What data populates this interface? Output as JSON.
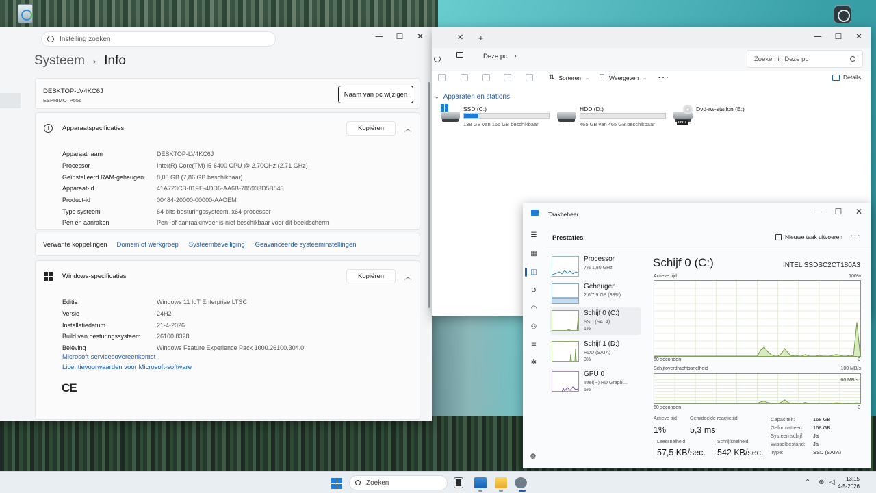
{
  "settings": {
    "search_placeholder": "Instelling zoeken",
    "breadcrumb_parent": "Systeem",
    "breadcrumb_current": "Info",
    "pc_name": "DESKTOP-LV4KC6J",
    "pc_model": "ESPRIMO_P556",
    "rename_button": "Naam van pc wijzigen",
    "device_specs": {
      "title": "Apparaatspecificaties",
      "copy_label": "Kopiëren",
      "rows": [
        {
          "k": "Apparaatnaam",
          "v": "DESKTOP-LV4KC6J"
        },
        {
          "k": "Processor",
          "v": "Intel(R) Core(TM) i5-6400 CPU @ 2.70GHz (2.71 GHz)"
        },
        {
          "k": "Geïnstalleerd RAM-geheugen",
          "v": "8,00 GB (7,86 GB beschikbaar)"
        },
        {
          "k": "Apparaat-id",
          "v": "41A723CB-01FE-4DD6-AA6B-785933D5B843"
        },
        {
          "k": "Product-id",
          "v": "00484-20000-00000-AAOEM"
        },
        {
          "k": "Type systeem",
          "v": "64-bits besturingssysteem, x64-processor"
        },
        {
          "k": "Pen en aanraken",
          "v": "Pen- of aanraakinvoer is niet beschikbaar voor dit beeldscherm"
        }
      ]
    },
    "related": {
      "label": "Verwante koppelingen",
      "links": [
        "Domein of werkgroep",
        "Systeembeveiliging",
        "Geavanceerde systeeminstellingen"
      ]
    },
    "windows_specs": {
      "title": "Windows-specificaties",
      "copy_label": "Kopiëren",
      "rows": [
        {
          "k": "Editie",
          "v": "Windows 11 IoT Enterprise LTSC"
        },
        {
          "k": "Versie",
          "v": "24H2"
        },
        {
          "k": "Installatiedatum",
          "v": "21-4-2026"
        },
        {
          "k": "Build van besturingssysteem",
          "v": "26100.8328"
        },
        {
          "k": "Beleving",
          "v": "Windows Feature Experience Pack 1000.26100.304.0"
        }
      ],
      "links": [
        "Microsoft-servicesovereenkomst",
        "Licentievoorwaarden voor Microsoft-software"
      ],
      "ce_mark": "CE"
    }
  },
  "explorer": {
    "address": "Deze pc",
    "search_placeholder": "Zoeken in Deze pc",
    "sort_label": "Sorteren",
    "view_label": "Weergeven",
    "details_label": "Details",
    "group_title": "Apparaten en stations",
    "drives": [
      {
        "name": "SSD (C:)",
        "free": "138 GB van 166 GB beschikbaar",
        "used_fraction": 0.17
      },
      {
        "name": "HDD (D:)",
        "free": "465 GB van 465 GB beschikbaar",
        "used_fraction": 0.0
      },
      {
        "name": "Dvd-rw-station (E:)",
        "badge": "DVD"
      }
    ]
  },
  "taskmgr": {
    "title": "Taakbeheer",
    "section": "Prestaties",
    "run_task": "Nieuwe taak uitvoeren",
    "items": [
      {
        "name": "Processor",
        "sub": "7% 1,80 GHz"
      },
      {
        "name": "Geheugen",
        "sub": "2,6/7,9 GB (33%)"
      },
      {
        "name": "Schijf 0 (C:)",
        "sub": "SSD (SATA)",
        "sub2": "1%"
      },
      {
        "name": "Schijf 1 (D:)",
        "sub": "HDD (SATA)",
        "sub2": "0%"
      },
      {
        "name": "GPU 0",
        "sub": "Intel(R) HD Graphi...",
        "sub2": "5%"
      }
    ],
    "detail": {
      "title": "Schijf 0 (C:)",
      "model": "INTEL SSDSC2CT180A3",
      "graph1_label": "Actieve tijd",
      "graph1_max": "100%",
      "graph1_xlabel": "60 seconden",
      "graph1_min": "0",
      "graph2_label": "Schijfoverdrachtssnelheid",
      "graph2_max": "100 MB/s",
      "graph2_mid": "60 MB/s",
      "graph2_xlabel": "60 seconden",
      "graph2_min": "0",
      "active_label": "Actieve tijd",
      "active_value": "1%",
      "latency_label": "Gemiddelde reactietijd",
      "latency_value": "5,3 ms",
      "read_label": "Leessnelheid",
      "read_value": "57,5 KB/sec.",
      "write_label": "Schrijfsnelheid",
      "write_value": "542 KB/sec.",
      "props": [
        {
          "k": "Capaciteit:",
          "v": "168 GB"
        },
        {
          "k": "Geformatteerd:",
          "v": "168 GB"
        },
        {
          "k": "Systeemschijf:",
          "v": "Ja"
        },
        {
          "k": "Wisselbestand:",
          "v": "Ja"
        },
        {
          "k": "Type:",
          "v": "SSD (SATA)"
        }
      ],
      "graph1_values": [
        0,
        0,
        0,
        0,
        0,
        0,
        0,
        0,
        0,
        0,
        0,
        0,
        0,
        0,
        0,
        0,
        0,
        0,
        0,
        0,
        0,
        0,
        0,
        0,
        0,
        0,
        0,
        0,
        0,
        0,
        0,
        8,
        12,
        6,
        2,
        0,
        0,
        3,
        10,
        4,
        0,
        1,
        0,
        0,
        2,
        0,
        0,
        0,
        1,
        0,
        0,
        0,
        1,
        2,
        1,
        0,
        0,
        1,
        0,
        45,
        0
      ],
      "graph2_values": [
        0,
        0,
        0,
        0,
        0,
        0,
        0,
        0,
        0,
        0,
        0,
        0,
        0,
        0,
        0,
        0,
        0,
        0,
        0,
        0,
        0,
        0,
        0,
        0,
        0,
        0,
        0,
        0,
        0,
        0,
        0,
        5,
        8,
        3,
        1,
        0,
        0,
        4,
        12,
        3,
        0,
        1,
        0,
        0,
        3,
        0,
        0,
        0,
        1,
        0,
        0,
        0,
        1,
        2,
        1,
        0,
        0,
        1,
        0,
        2,
        0
      ]
    }
  },
  "taskbar": {
    "search_placeholder": "Zoeken",
    "time": "13:15",
    "date": "4-5-2026"
  }
}
